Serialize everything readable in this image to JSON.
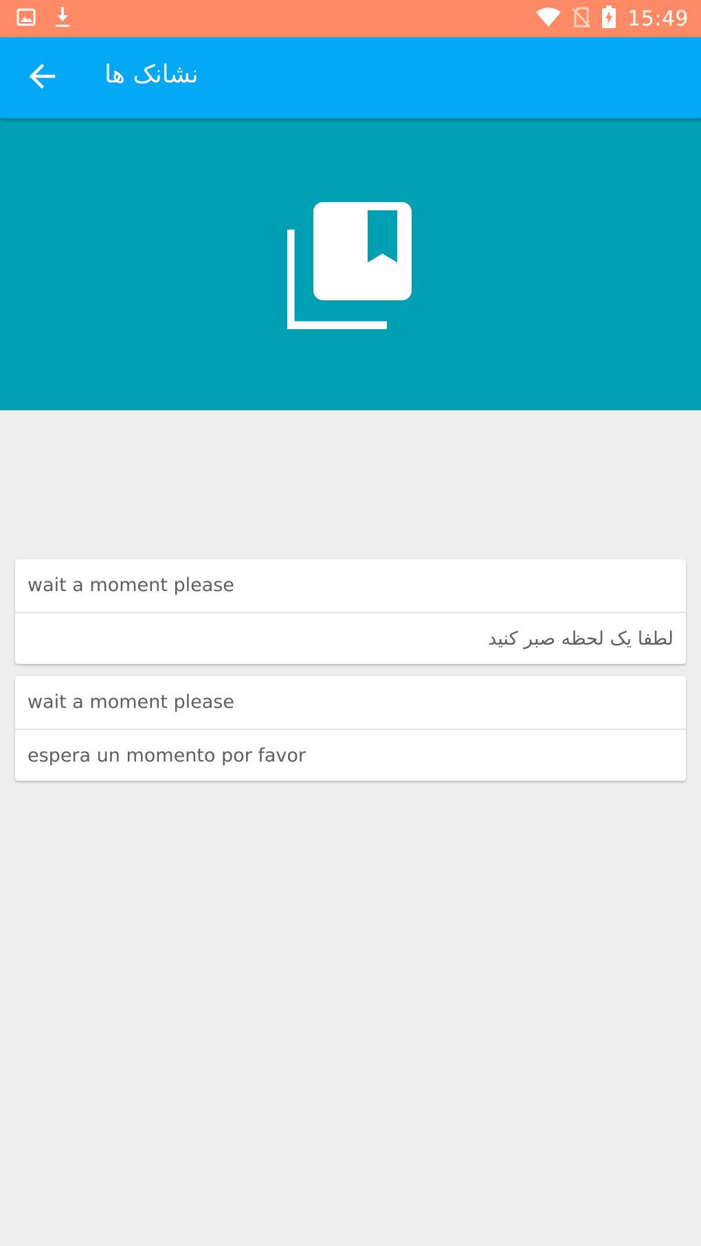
{
  "status_bar": {
    "time": "15:49",
    "left_icons": [
      "image-icon",
      "download-icon"
    ],
    "right_icons": [
      "wifi-icon",
      "no-sim-icon",
      "battery-charging-icon"
    ],
    "background": "#ff8a65"
  },
  "app_bar": {
    "title": "نشانک ها",
    "back_icon": "arrow-back-icon",
    "background": "#03a9f4"
  },
  "header": {
    "icon": "bookmarks-collection-icon",
    "background": "#00a0b4"
  },
  "bookmarks": [
    {
      "source": "wait a moment please",
      "translation": "لطفا یک لحظه صبر کنید",
      "translation_direction": "rtl"
    },
    {
      "source": "wait a moment please",
      "translation": "espera un momento por favor",
      "translation_direction": "ltr"
    }
  ]
}
